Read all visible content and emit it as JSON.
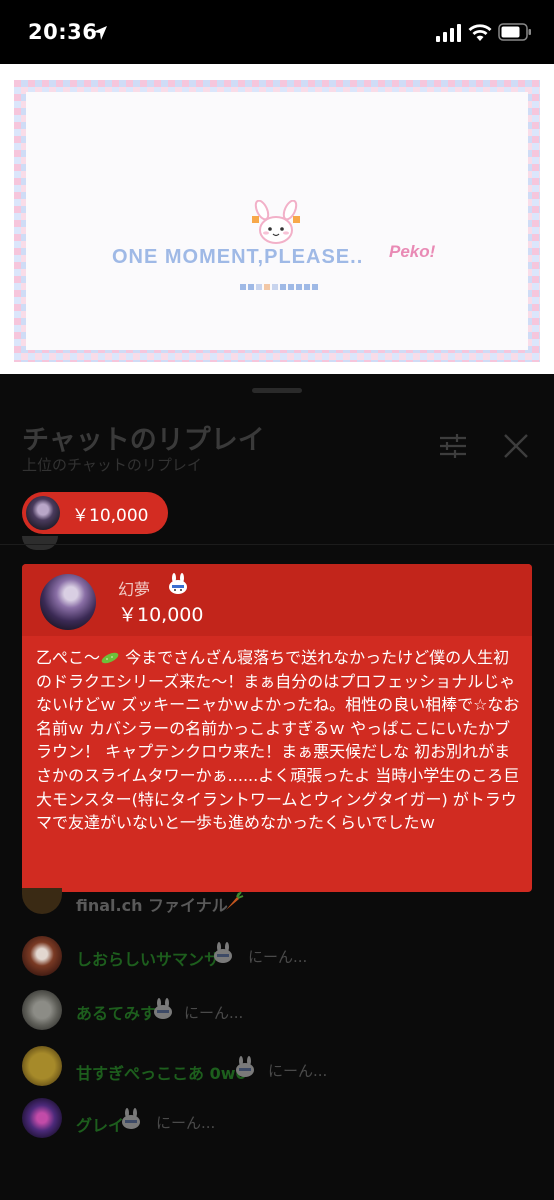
{
  "status_bar": {
    "time": "20:36"
  },
  "video": {
    "message": "ONE MOMENT,PLEASE..",
    "signature": "Peko!"
  },
  "chat": {
    "title": "チャットのリプレイ",
    "subtitle": "上位のチャットのリプレイ",
    "pinned_donation": {
      "amount": "￥10,000"
    },
    "superchat": {
      "author": "幻夢",
      "amount": "￥10,000",
      "message_before_emoji": "乙ぺこ〜",
      "message_after_emoji": " 今までさんざん寝落ちで送れなかったけど僕の人生初のドラクエシリーズ来た〜！まぁ自分のはプロフェッショナルじゃないけどｗ ズッキーニャかｗよかったね。相性の良い相棒で☆なお名前ｗ カバシラーの名前かっこよすぎるｗ やっぱここにいたかブラウン！ キャプテンクロウ来た！まぁ悪天候だしな 初お別れがまさかのスライムタワーかぁ......よく頑張ったよ 当時小学生のころ巨大モンスター(特にタイラントワームとウィングタイガー) がトラウマで友達がいないと一歩も進めなかったくらいでしたｗ"
    },
    "messages": [
      {
        "author": "final.ch ファイナル",
        "text": "",
        "name_color": "#5a5a5a",
        "avatar_color": "#3a2a14",
        "badge": "carrot-icon"
      },
      {
        "author": "しおらしいサマンサ",
        "text": "にーん...",
        "name_color": "#1d5e1d",
        "avatar_color": "#5a2318",
        "badge": "bunny-badge-icon"
      },
      {
        "author": "あるてみす",
        "text": "にーん...",
        "name_color": "#1d5e1d",
        "avatar_color": "#6a6a63",
        "badge": "bunny-badge-icon"
      },
      {
        "author": "甘すぎぺっここあ 0w0",
        "text": "にーん...",
        "name_color": "#1d5e1d",
        "avatar_color": "#7a6420",
        "badge": "bunny-badge-icon"
      },
      {
        "author": "グレイ",
        "text": "にーん...",
        "name_color": "#1d5e1d",
        "avatar_color": "#3a1f4e",
        "badge": "bunny-badge-icon"
      }
    ]
  },
  "colors": {
    "superchat_body": "#d12b21",
    "superchat_header": "#c2251b",
    "pill": "#d32c22",
    "member_name": "#1d5e1d"
  }
}
